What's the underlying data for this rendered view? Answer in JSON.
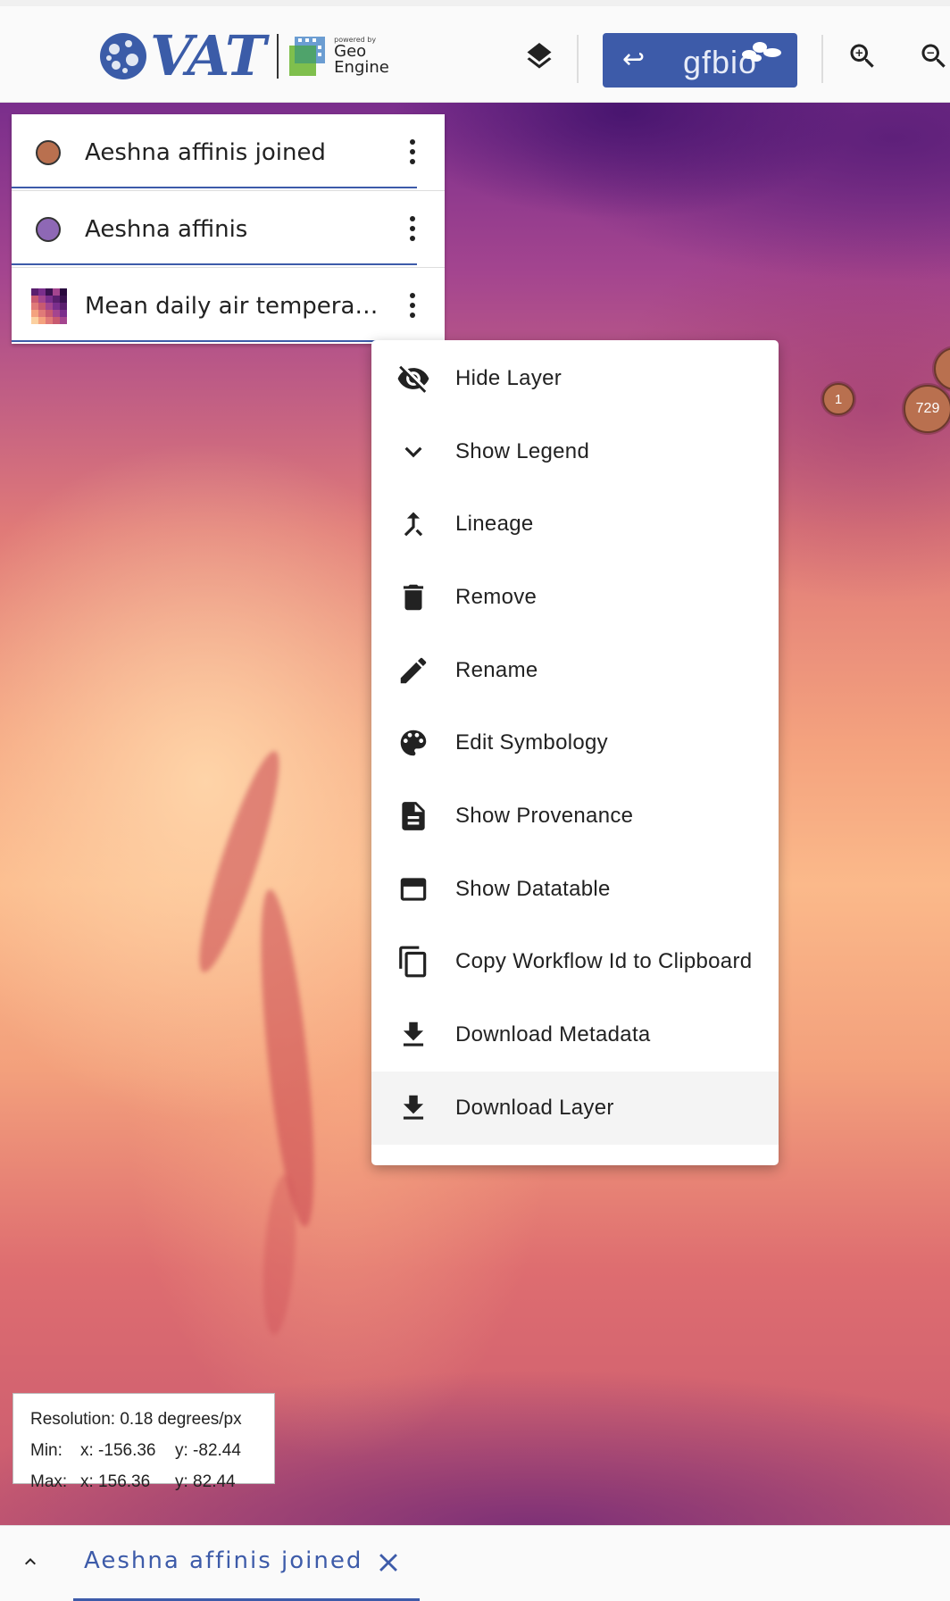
{
  "toolbar": {
    "logo_text": "VAT",
    "powered_by": "powered by",
    "geo_engine_line1": "Geo",
    "geo_engine_line2": "Engine",
    "layers_icon": "layers-icon",
    "gfbio_button": {
      "arrow": "↩",
      "label": "gfbio"
    },
    "zoom_in_icon": "zoom-in-icon",
    "zoom_out_icon": "zoom-out-icon",
    "accent_color": "#3d5ba9"
  },
  "layers": [
    {
      "name": "Aeshna affinis joined",
      "symbol": "circle",
      "color": "#b9704f"
    },
    {
      "name": "Aeshna affinis",
      "symbol": "circle",
      "color": "#8e68b5"
    },
    {
      "name": "Mean daily air temperatu…",
      "symbol": "raster-colormap",
      "color": "#c85a70"
    }
  ],
  "clusters": [
    {
      "label": "1"
    },
    {
      "label": "729"
    }
  ],
  "context_menu": {
    "items": [
      {
        "label": "Hide Layer",
        "icon": "visibility-off-icon"
      },
      {
        "label": "Show Legend",
        "icon": "chevron-down-icon"
      },
      {
        "label": "Lineage",
        "icon": "merge-icon"
      },
      {
        "label": "Remove",
        "icon": "trash-icon"
      },
      {
        "label": "Rename",
        "icon": "pencil-icon"
      },
      {
        "label": "Edit Symbology",
        "icon": "palette-icon"
      },
      {
        "label": "Show Provenance",
        "icon": "document-icon"
      },
      {
        "label": "Show Datatable",
        "icon": "table-window-icon"
      },
      {
        "label": "Copy Workflow Id to Clipboard",
        "icon": "copy-icon"
      },
      {
        "label": "Download Metadata",
        "icon": "download-icon"
      },
      {
        "label": "Download Layer",
        "icon": "download-icon",
        "hovered": true
      }
    ]
  },
  "resolution": {
    "resolution_text": "Resolution: 0.18 degrees/px",
    "min_label": "Min:",
    "min_x": "x: -156.36",
    "min_y": "y: -82.44",
    "max_label": "Max:",
    "max_x": "x: 156.36",
    "max_y": "y: 82.44"
  },
  "bottom_bar": {
    "tab_label": "Aeshna affinis joined"
  }
}
